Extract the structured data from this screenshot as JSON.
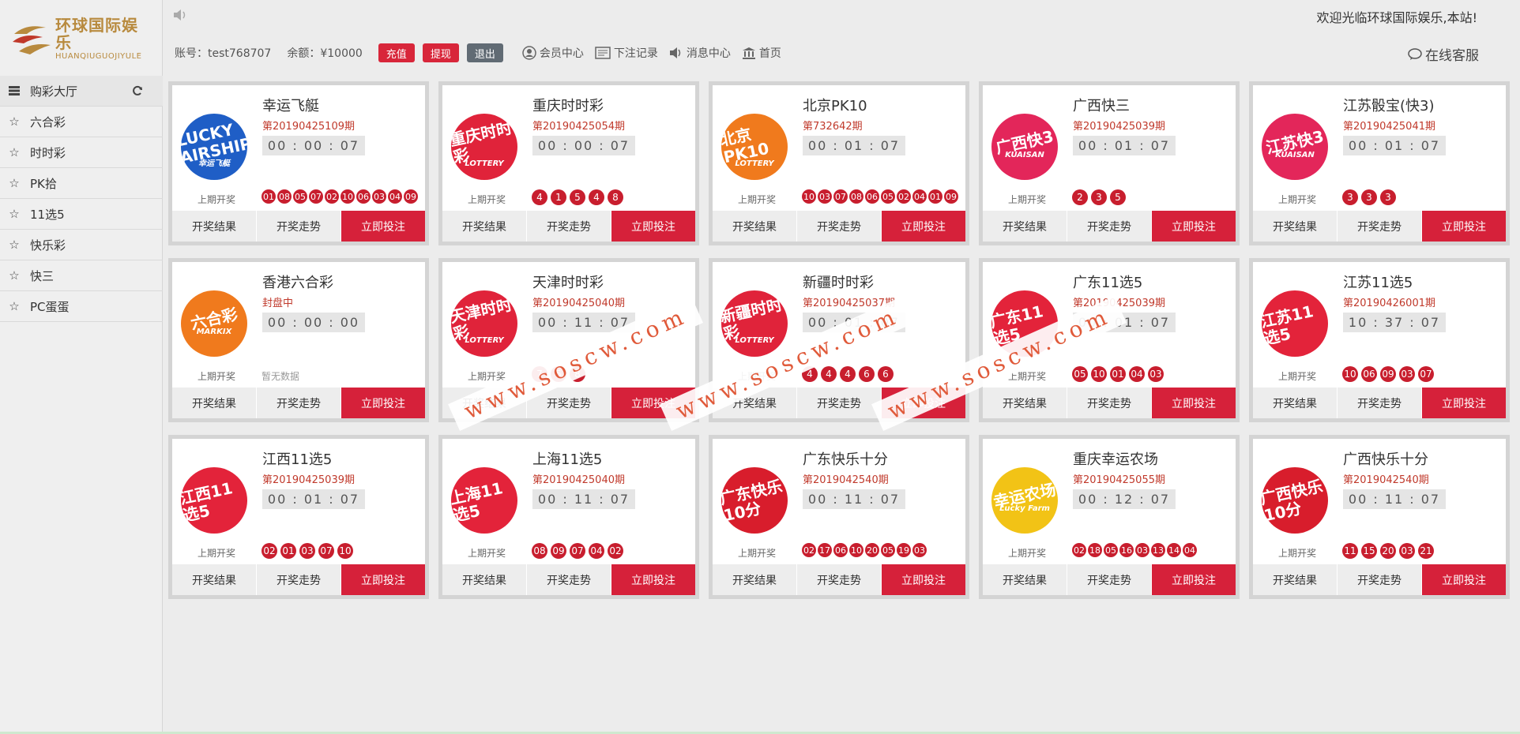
{
  "brand": {
    "title": "环球国际娱乐",
    "sub": "HUANQIUGUOJIYULE"
  },
  "welcome": "欢迎光临环球国际娱乐,本站!",
  "account": {
    "user": "账号：test768707",
    "balance": "余额：¥10000"
  },
  "actions": {
    "deposit": "充值",
    "withdraw": "提现",
    "logout": "退出"
  },
  "links": {
    "member": "会员中心",
    "orders": "下注记录",
    "messages": "消息中心",
    "home": "首页"
  },
  "service": "在线客服",
  "sidebar": {
    "hall": "购彩大厅",
    "items": [
      "六合彩",
      "时时彩",
      "PK拾",
      "11选5",
      "快乐彩",
      "快三",
      "PC蛋蛋"
    ]
  },
  "labels": {
    "last": "上期开奖",
    "result": "开奖结果",
    "trend": "开奖走势",
    "bet": "立即投注",
    "no_data": "暂无数据"
  },
  "watermark": "www.soscw.com",
  "games": [
    {
      "name": "幸运飞艇",
      "issue": "第20190425109期",
      "timer": "00 : 00 : 07",
      "logo": [
        "LUCKY AIRSHIP",
        "幸运飞艇"
      ],
      "color": "#1f5ec6",
      "nums": [
        "01",
        "08",
        "05",
        "07",
        "02",
        "10",
        "06",
        "03",
        "04",
        "09"
      ]
    },
    {
      "name": "重庆时时彩",
      "issue": "第20190425054期",
      "timer": "00 : 00 : 07",
      "logo": [
        "重庆时时彩",
        "LOTTERY"
      ],
      "color": "#e0233a",
      "nums": [
        "4",
        "1",
        "5",
        "4",
        "8"
      ]
    },
    {
      "name": "北京PK10",
      "issue": "第732642期",
      "timer": "00 : 01 : 07",
      "logo": [
        "北京PK10",
        "LOTTERY"
      ],
      "color": "#f07a1d",
      "nums": [
        "10",
        "03",
        "07",
        "08",
        "06",
        "05",
        "02",
        "04",
        "01",
        "09"
      ]
    },
    {
      "name": "广西快三",
      "issue": "第20190425039期",
      "timer": "00 : 01 : 07",
      "logo": [
        "广西快3",
        "KUAISAN"
      ],
      "color": "#e3265a",
      "nums": [
        "2",
        "3",
        "5"
      ]
    },
    {
      "name": "江苏骰宝(快3)",
      "issue": "第20190425041期",
      "timer": "00 : 01 : 07",
      "logo": [
        "江苏快3",
        "KUAISAN"
      ],
      "color": "#e3265a",
      "nums": [
        "3",
        "3",
        "3"
      ]
    },
    {
      "name": "香港六合彩",
      "issue": "封盘中",
      "timer": "00 : 00 : 00",
      "logo": [
        "六合彩",
        "MARKIX"
      ],
      "color": "#f07a1d",
      "nums": []
    },
    {
      "name": "天津时时彩",
      "issue": "第20190425040期",
      "timer": "00 : 11 : 07",
      "logo": [
        "天津时时彩",
        "LOTTERY"
      ],
      "color": "#e0233a",
      "nums": [
        "7",
        "5",
        "8"
      ]
    },
    {
      "name": "新疆时时彩",
      "issue": "第20190425037期",
      "timer": "00 : 01 : 07",
      "logo": [
        "新疆时时彩",
        "LOTTERY"
      ],
      "color": "#e0233a",
      "nums": [
        "4",
        "4",
        "4",
        "6",
        "6"
      ]
    },
    {
      "name": "广东11选5",
      "issue": "第20190425039期",
      "timer": "00 : 01 : 07",
      "logo": [
        "广东11选5",
        ""
      ],
      "color": "#e3233a",
      "nums": [
        "05",
        "10",
        "01",
        "04",
        "03"
      ]
    },
    {
      "name": "江苏11选5",
      "issue": "第20190426001期",
      "timer": "10 : 37 : 07",
      "logo": [
        "江苏11选5",
        ""
      ],
      "color": "#e3233a",
      "nums": [
        "10",
        "06",
        "09",
        "03",
        "07"
      ]
    },
    {
      "name": "江西11选5",
      "issue": "第20190425039期",
      "timer": "00 : 01 : 07",
      "logo": [
        "江西11选5",
        ""
      ],
      "color": "#e3233a",
      "nums": [
        "02",
        "01",
        "03",
        "07",
        "10"
      ]
    },
    {
      "name": "上海11选5",
      "issue": "第20190425040期",
      "timer": "00 : 11 : 07",
      "logo": [
        "上海11选5",
        ""
      ],
      "color": "#e3233a",
      "nums": [
        "08",
        "09",
        "07",
        "04",
        "02"
      ]
    },
    {
      "name": "广东快乐十分",
      "issue": "第2019042540期",
      "timer": "00 : 11 : 07",
      "logo": [
        "广东快乐10分",
        ""
      ],
      "color": "#d81d2c",
      "nums": [
        "02",
        "17",
        "06",
        "10",
        "20",
        "05",
        "19",
        "03"
      ]
    },
    {
      "name": "重庆幸运农场",
      "issue": "第20190425055期",
      "timer": "00 : 12 : 07",
      "logo": [
        "幸运农场",
        "Lucky Farm"
      ],
      "color": "#f2c316",
      "nums": [
        "02",
        "18",
        "05",
        "16",
        "03",
        "13",
        "14",
        "04"
      ]
    },
    {
      "name": "广西快乐十分",
      "issue": "第2019042540期",
      "timer": "00 : 11 : 07",
      "logo": [
        "广西快乐10分",
        ""
      ],
      "color": "#d81d2c",
      "nums": [
        "11",
        "15",
        "20",
        "03",
        "21"
      ]
    }
  ]
}
